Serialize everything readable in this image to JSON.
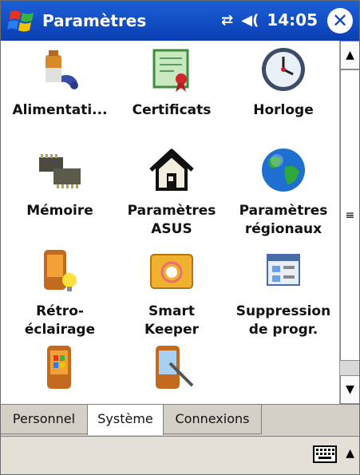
{
  "titlebar": {
    "title": "Paramètres",
    "time": "14:05",
    "connectivity_icon": "sync-arrows-icon",
    "volume_icon": "speaker-icon",
    "close_label": "✕"
  },
  "tiles": [
    {
      "label": "Alimentati...",
      "icon": "battery-icon"
    },
    {
      "label": "Certificats",
      "icon": "certificate-icon"
    },
    {
      "label": "Horloge",
      "icon": "clock-icon"
    },
    {
      "label": "Mémoire",
      "icon": "memory-chip-icon"
    },
    {
      "label": "Paramètres\nASUS",
      "icon": "house-icon"
    },
    {
      "label": "Paramètres\nrégionaux",
      "icon": "globe-icon"
    },
    {
      "label": "Rétro-\néclairage",
      "icon": "backlight-icon"
    },
    {
      "label": "Smart\nKeeper",
      "icon": "folder-icon"
    },
    {
      "label": "Suppression\nde progr.",
      "icon": "remove-programs-icon"
    },
    {
      "label": "",
      "icon": "start-menu-device-icon"
    },
    {
      "label": "",
      "icon": "screen-stylus-icon"
    }
  ],
  "tabs": [
    {
      "label": "Personnel",
      "active": false
    },
    {
      "label": "Système",
      "active": true
    },
    {
      "label": "Connexions",
      "active": false
    }
  ],
  "bottombar": {
    "input_icon": "keyboard-icon"
  }
}
